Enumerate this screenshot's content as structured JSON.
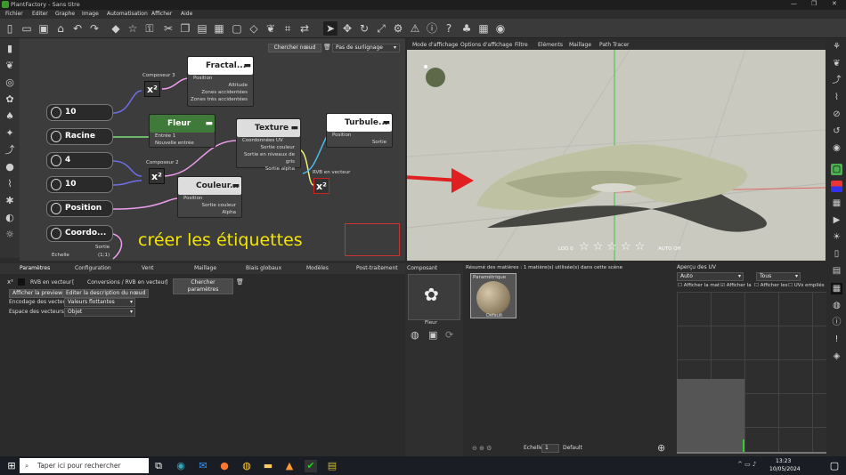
{
  "window": {
    "title": "PlantFactory - Sans titre",
    "controls": [
      "—",
      "❐",
      "✕"
    ]
  },
  "menu": [
    "Fichier",
    "Editer",
    "Graphe",
    "Image",
    "Automatisation",
    "Afficher",
    "Aide"
  ],
  "graph": {
    "search_button": "Chercher nœud",
    "highlight": "Pas de surlignage",
    "nodes": {
      "n10a": "10",
      "racine": "Racine",
      "n4": "4",
      "n10b": "10",
      "position": "Position",
      "coord": "Coordo...",
      "coord_out": "Sortie",
      "coord_echelle": "Echelle",
      "coord_echelle_val": "(1;1)",
      "fractal": "Fractal...",
      "fractal_ports": [
        "Position",
        "Altitude",
        "Zones accidentées",
        "Zones très accidentées"
      ],
      "compo3": "Composeur 3",
      "compo2": "Composeur 2",
      "fleur": "Fleur",
      "fleur_ports": [
        "Entrée 1",
        "Nouvelle entrée"
      ],
      "texture": "Texture",
      "texture_ports": [
        "Coordonnées UV",
        "Sortie couleur",
        "Sortie en niveaux de gris",
        "Sortie alpha"
      ],
      "couleur": "Couleur...",
      "couleur_ports": [
        "Position",
        "Sortie couleur",
        "Alpha"
      ],
      "turbule": "Turbule...",
      "turbule_ports": [
        "Position",
        "Sortie"
      ],
      "rvb": "RVB en vecteur",
      "x2": "x²"
    },
    "annotation": "créer les étiquettes"
  },
  "viewport": {
    "menu": [
      "Mode d'affichage",
      "Options d'affichage",
      "Filtre",
      "Eléments",
      "Maillage",
      "Path Tracer"
    ],
    "lod": "LOD 0",
    "stars": 5,
    "auto": "AUTO Off"
  },
  "panel_tabs": [
    "Paramètres",
    "Configuration",
    "Vent",
    "Maillage",
    "Biais globaux",
    "Modèles",
    "Post-traitement"
  ],
  "params": {
    "node_name": "RVB en vecteur",
    "path": "Conversions / RVB en vecteur",
    "search": "Chercher paramètres",
    "show_preview": "Afficher la preview",
    "edit_desc": "Editer la description du nœud",
    "encodage_label": "Encodage des vecteurs",
    "encodage_value": "Valeurs flottantes",
    "espace_label": "Espace des vecteurs",
    "espace_value": "Objet"
  },
  "composant": {
    "title": "Composant",
    "item": "Fleur"
  },
  "matieres": {
    "summary": "Résumé des matières : 1 matière(s) utilisée(s) dans cette scène",
    "mat_type": "Paramétrique",
    "mat_name": "Default",
    "echelle_label": "Echelle",
    "echelle_value": "1",
    "default": "Default"
  },
  "uv": {
    "title": "Aperçu des UV",
    "sel1": "Auto",
    "sel2": "Tous",
    "checks": [
      "Afficher la mat",
      "Afficher la",
      "Afficher les",
      "UVs empilés"
    ]
  },
  "taskbar": {
    "search": "Taper ici pour rechercher",
    "time": "13:23",
    "date": "10/05/2024"
  },
  "colors": {
    "accent_red": "#e02020",
    "annotation": "#f5e500",
    "fleur_node": "#3f7a3a"
  }
}
